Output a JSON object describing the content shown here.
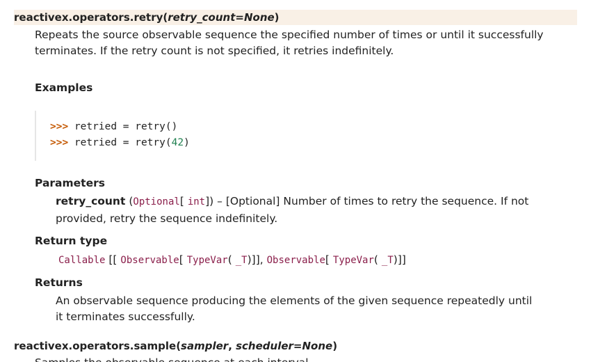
{
  "retry": {
    "sig_name": "reactivex.operators.retry(",
    "sig_param": "retry_count",
    "sig_default": "=None",
    "sig_close": ")",
    "description": "Repeats the source observable sequence the specified number of times or until it successfully terminates. If the retry count is not specified, it retries indefinitely.",
    "examples_heading": "Examples",
    "code_prompt": ">>>",
    "code_line1": "retried = retry()",
    "code_line2_pre": "retried = retry(",
    "code_line2_num": "42",
    "code_line2_post": ")",
    "parameters_heading": "Parameters",
    "param_name": "retry_count",
    "param_type_open": "(",
    "param_type_optional": "Optional",
    "param_type_bracket_open": "[",
    "param_type_int": "int",
    "param_type_close": "])",
    "param_desc": "– [Optional] Number of times to retry the sequence. If not provided, retry the sequence indefinitely.",
    "return_type_heading": "Return type",
    "rtype_callable": "Callable",
    "rtype_part1": "[[",
    "rtype_observable1": "Observable",
    "rtype_part2": "[",
    "rtype_typevar1": "TypeVar",
    "rtype_part3": "(",
    "rtype_t1": "_T",
    "rtype_part4": ")]],",
    "rtype_observable2": "Observable",
    "rtype_part5": "[",
    "rtype_typevar2": "TypeVar",
    "rtype_part6": "(",
    "rtype_t2": "_T",
    "rtype_part7": ")]]",
    "returns_heading": "Returns",
    "returns_text": "An observable sequence producing the elements of the given sequence repeatedly until it terminates successfully."
  },
  "sample": {
    "sig_name": "reactivex.operators.sample(",
    "sig_param1": "sampler",
    "sig_sep": ", ",
    "sig_param2": "scheduler",
    "sig_default": "=None",
    "sig_close": ")",
    "description_cut": "Samples the observable sequence at each interval"
  }
}
